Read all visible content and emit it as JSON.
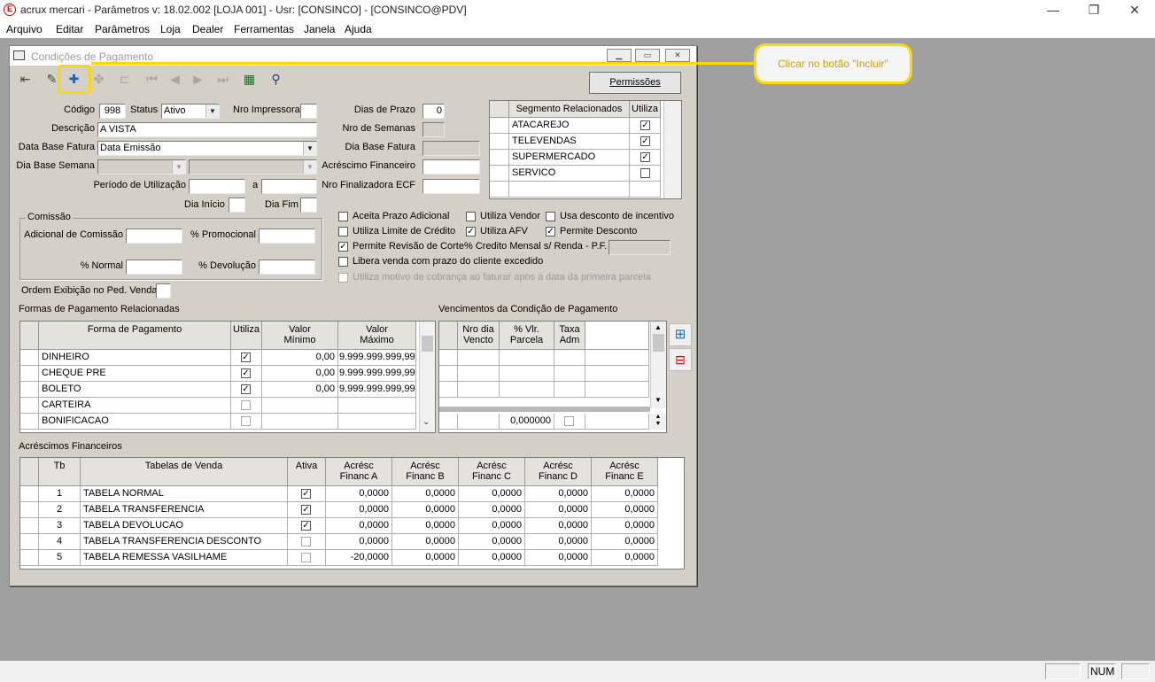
{
  "app": {
    "icon_letter": "E",
    "title": "acrux mercari - Parâmetros  v: 18.02.002  [LOJA 001] - Usr: [CONSINCO] - [CONSINCO@PDV]",
    "minimize": "—",
    "maximize": "❐",
    "close": "✕"
  },
  "menu": [
    "Arquivo",
    "Editar",
    "Parâmetros",
    "Loja",
    "Dealer",
    "Ferramentas",
    "Janela",
    "Ajuda"
  ],
  "window": {
    "title": "Condições de Pagamento",
    "permissions_label": "Permissões"
  },
  "callout": "Clicar no botão \"Incluir\"",
  "form": {
    "codigo_label": "Código",
    "codigo": "998",
    "status_label": "Status",
    "status": "Ativo",
    "nro_impressora_label": "Nro Impressora",
    "descricao_label": "Descrição",
    "descricao": "A VISTA",
    "data_base_fatura_label": "Data Base Fatura",
    "data_base_fatura": "Data Emissão",
    "dia_base_semana_label": "Dia Base Semana",
    "periodo_label": "Período de Utilização",
    "periodo_a": "a",
    "dia_inicio_label": "Dia Início",
    "dia_fim_label": "Dia Fim",
    "dias_prazo_label": "Dias de Prazo",
    "dias_prazo": "0",
    "nro_semanas_label": "Nro de Semanas",
    "dia_base_fatura_label": "Dia Base Fatura",
    "acrescimo_label": "Acréscimo Financeiro",
    "nro_finalizadora_label": "Nro Finalizadora ECF",
    "ordem_label": "Ordem Exibição no Ped. Venda"
  },
  "comissao": {
    "title": "Comissão",
    "adicional_label": "Adicional de Comissão",
    "promocional_label": "% Promocional",
    "normal_label": "% Normal",
    "devolucao_label": "% Devolução"
  },
  "segmentos": {
    "header_name": "Segmento Relacionados",
    "header_use": "Utiliza",
    "rows": [
      {
        "name": "ATACAREJO",
        "check": "✓"
      },
      {
        "name": "TELEVENDAS",
        "check": "✓"
      },
      {
        "name": "SUPERMERCADO",
        "check": "✓"
      },
      {
        "name": "SERVICO",
        "check": ""
      }
    ]
  },
  "options": {
    "aceita_prazo": "Aceita Prazo Adicional",
    "utiliza_vendor": "Utiliza Vendor",
    "usa_desconto": "Usa desconto de incentivo",
    "utiliza_limite": "Utiliza Limite de Crédito",
    "utiliza_afv": "Utiliza AFV",
    "permite_desconto": "Permite Desconto",
    "permite_revisao": "Permite Revisão de Corte",
    "credito_mensal": "% Credito Mensal s/ Renda - P.F.",
    "libera_venda": "Libera venda com prazo do cliente excedido",
    "motivo_cobranca": "Utiliza motivo de cobrança ao faturar após a data da primeira parcela",
    "check": "✓"
  },
  "formas": {
    "title": "Formas de Pagamento Relacionadas",
    "h_forma": "Forma de Pagamento",
    "h_utiliza": "Utiliza",
    "h_vmin1": "Valor",
    "h_vmin2": "Mínimo",
    "h_vmax1": "Valor",
    "h_vmax2": "Máximo",
    "rows": [
      {
        "forma": "DINHEIRO",
        "check": "✓",
        "min": "0,00",
        "max": "9.999.999.999,99"
      },
      {
        "forma": "CHEQUE PRE",
        "check": "✓",
        "min": "0,00",
        "max": "9.999.999.999,99"
      },
      {
        "forma": "BOLETO",
        "check": "✓",
        "min": "0,00",
        "max": "9.999.999.999,99"
      },
      {
        "forma": "CARTEIRA",
        "check": "",
        "min": "",
        "max": ""
      },
      {
        "forma": "BONIFICACAO",
        "check": "",
        "min": "",
        "max": ""
      }
    ]
  },
  "vencimentos": {
    "title": "Vencimentos da Condição de Pagamento",
    "h_nro1": "Nro dia",
    "h_nro2": "Vencto",
    "h_vlr1": "% Vlr.",
    "h_vlr2": "Parcela",
    "h_taxa1": "Taxa",
    "h_taxa2": "Adm",
    "total": "0,000000"
  },
  "acrescimos": {
    "title": "Acréscimos Financeiros",
    "h_tb": "Tb",
    "h_tabelas": "Tabelas de Venda",
    "h_ativa": "Ativa",
    "h_a1": "Acrésc",
    "h_a2": "Financ A",
    "h_b1": "Acrésc",
    "h_b2": "Financ B",
    "h_c1": "Acrésc",
    "h_c2": "Financ C",
    "h_d1": "Acrésc",
    "h_d2": "Financ D",
    "h_e1": "Acrésc",
    "h_e2": "Financ E",
    "rows": [
      {
        "tb": "1",
        "tabela": "TABELA NORMAL",
        "check": "✓",
        "a": "0,0000",
        "b": "0,0000",
        "c": "0,0000",
        "d": "0,0000",
        "e": "0,0000"
      },
      {
        "tb": "2",
        "tabela": "TABELA TRANSFERENCIA",
        "check": "✓",
        "a": "0,0000",
        "b": "0,0000",
        "c": "0,0000",
        "d": "0,0000",
        "e": "0,0000"
      },
      {
        "tb": "3",
        "tabela": "TABELA DEVOLUCAO",
        "check": "✓",
        "a": "0,0000",
        "b": "0,0000",
        "c": "0,0000",
        "d": "0,0000",
        "e": "0,0000"
      },
      {
        "tb": "4",
        "tabela": "TABELA TRANSFERENCIA DESCONTO",
        "check": "",
        "a": "0,0000",
        "b": "0,0000",
        "c": "0,0000",
        "d": "0,0000",
        "e": "0,0000"
      },
      {
        "tb": "5",
        "tabela": "TABELA REMESSA VASILHAME",
        "check": "",
        "a": "-20,0000",
        "b": "0,0000",
        "c": "0,0000",
        "d": "0,0000",
        "e": "0,0000"
      }
    ]
  },
  "status": {
    "num": "NUM"
  }
}
